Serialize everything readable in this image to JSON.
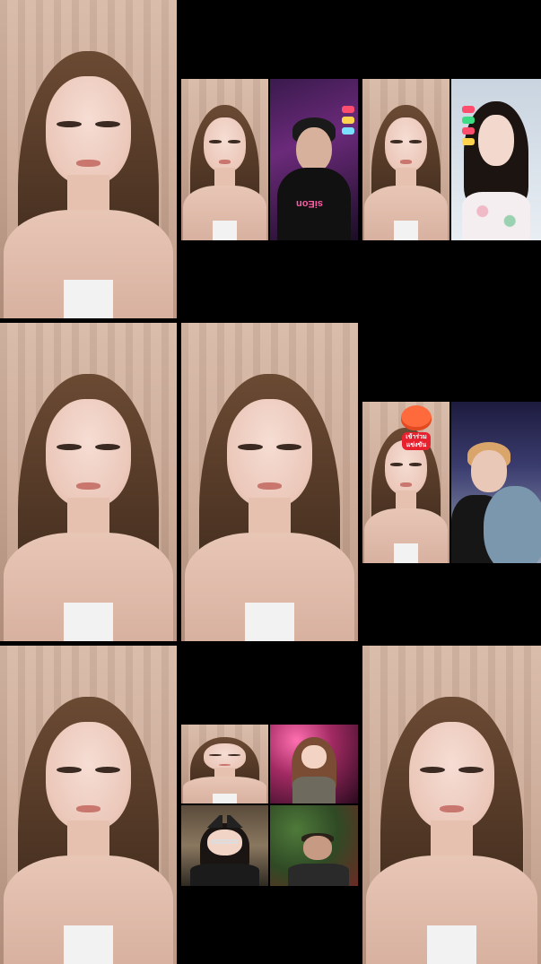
{
  "layout": {
    "rows": 3,
    "cols": 3
  },
  "tiles": [
    {
      "id": "tile-0-0",
      "type": "solo-stream"
    },
    {
      "id": "tile-0-1",
      "type": "duo-stream",
      "guests": [
        "host",
        "guest-dark-neon"
      ],
      "guest_shirt_text": "siEon"
    },
    {
      "id": "tile-0-2",
      "type": "duo-stream",
      "guests": [
        "host",
        "guest-light"
      ]
    },
    {
      "id": "tile-1-0",
      "type": "solo-stream"
    },
    {
      "id": "tile-1-1",
      "type": "solo-stream"
    },
    {
      "id": "tile-1-2",
      "type": "duo-stream",
      "guests": [
        "host",
        "guest-blue"
      ],
      "gift_text": "เข้าร่วม\nแข่งขัน"
    },
    {
      "id": "tile-2-0",
      "type": "solo-stream"
    },
    {
      "id": "tile-2-1",
      "type": "quad-stream",
      "guests": [
        "host",
        "guest-neon",
        "guest-room",
        "guest-plant"
      ]
    },
    {
      "id": "tile-2-2",
      "type": "solo-stream"
    }
  ],
  "colors": {
    "background": "#000000",
    "curtain": "#cba895",
    "gift_red": "#e8212e",
    "gift_orange": "#ff6a3d"
  }
}
